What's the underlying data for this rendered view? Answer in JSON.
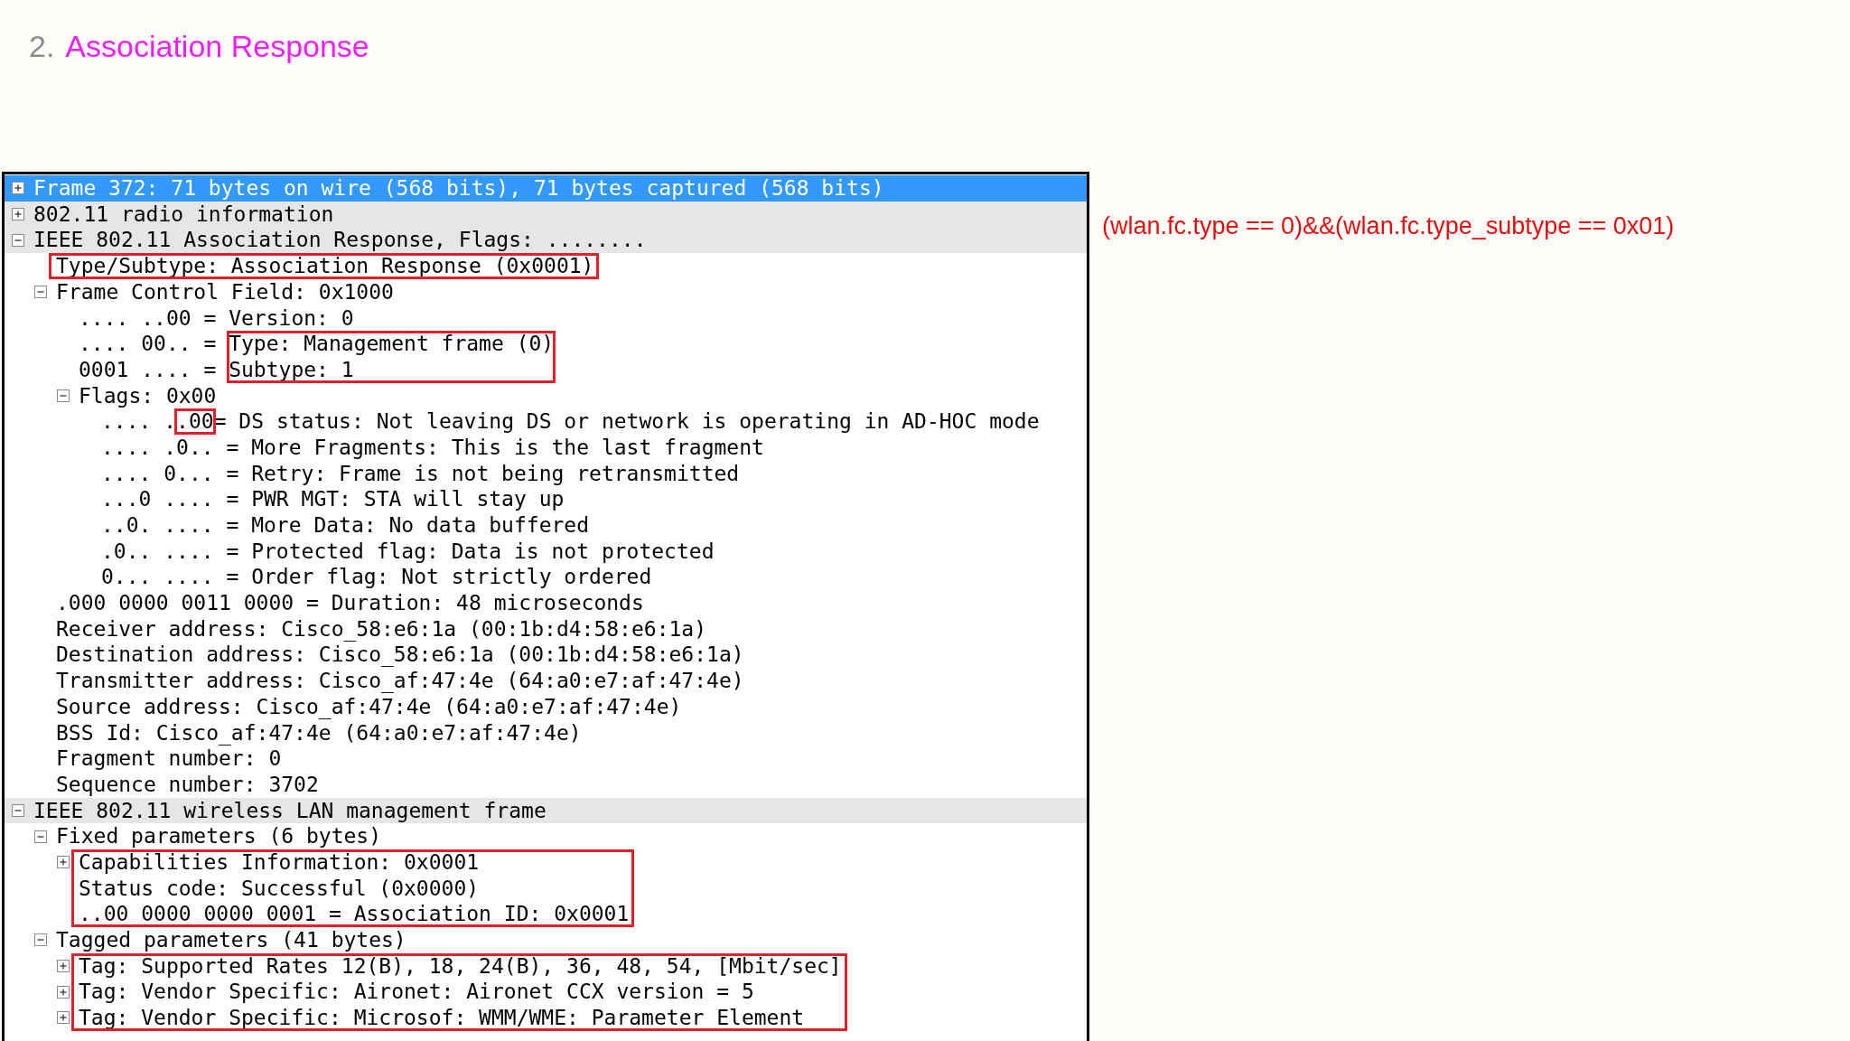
{
  "slide_title": {
    "number": "2.",
    "text": "Association Response"
  },
  "filter_note": "(wlan.fc.type == 0)&&(wlan.fc.type_subtype == 0x01)",
  "packet_details": [
    {
      "text": "Frame 372: 71 bytes on wire (568 bits), 71 bytes captured (568 bits)",
      "expanded": false,
      "selected": true
    },
    {
      "text": "802.11 radio information",
      "expanded": false,
      "selected": false
    },
    {
      "text": "IEEE 802.11 Association Response, Flags: ........",
      "expanded": true,
      "selected": false,
      "children": [
        {
          "text": "Type/Subtype: Association Response (0x0001)",
          "boxed": true
        },
        {
          "text": "Frame Control Field: 0x1000",
          "expanded": true,
          "children": [
            {
              "text": ".... ..00 = Version: 0"
            },
            {
              "parts": [
                {
                  "text": ".... 00.. = ",
                  "boxed": false
                },
                {
                  "text": "Type: Management frame (0)",
                  "boxed": true
                }
              ]
            },
            {
              "parts": [
                {
                  "text": "0001 .... = ",
                  "boxed": false
                },
                {
                  "text": "Subtype: 1",
                  "boxed": true
                }
              ]
            },
            {
              "text": "Flags: 0x00",
              "expanded": true,
              "children": [
                {
                  "parts": [
                    {
                      "text": ".... .",
                      "boxed": false
                    },
                    {
                      "text": ".00",
                      "boxed": true
                    },
                    {
                      "text": "= DS status: Not leaving DS or network is operating in AD-HOC mode",
                      "boxed": false
                    }
                  ]
                },
                {
                  "text": ".... .0.. = More Fragments: This is the last fragment"
                },
                {
                  "text": ".... 0... = Retry: Frame is not being retransmitted"
                },
                {
                  "text": "...0 .... = PWR MGT: STA will stay up"
                },
                {
                  "text": "..0. .... = More Data: No data buffered"
                },
                {
                  "text": ".0.. .... = Protected flag: Data is not protected"
                },
                {
                  "text": "0... .... = Order flag: Not strictly ordered"
                }
              ]
            }
          ]
        },
        {
          "text": ".000 0000 0011 0000 = Duration: 48 microseconds"
        },
        {
          "text": "Receiver address: Cisco_58:e6:1a (00:1b:d4:58:e6:1a)"
        },
        {
          "text": "Destination address: Cisco_58:e6:1a (00:1b:d4:58:e6:1a)"
        },
        {
          "text": "Transmitter address: Cisco_af:47:4e (64:a0:e7:af:47:4e)"
        },
        {
          "text": "Source address: Cisco_af:47:4e (64:a0:e7:af:47:4e)"
        },
        {
          "text": "BSS Id: Cisco_af:47:4e (64:a0:e7:af:47:4e)"
        },
        {
          "text": "Fragment number: 0"
        },
        {
          "text": "Sequence number: 3702"
        }
      ]
    },
    {
      "text": "IEEE 802.11 wireless LAN management frame",
      "expanded": true,
      "selected": false,
      "children": [
        {
          "text": "Fixed parameters (6 bytes)",
          "expanded": true,
          "children": [
            {
              "text": "Capabilities Information: 0x0001",
              "expanded": false,
              "boxed": true
            },
            {
              "text": "Status code: Successful (0x0000)",
              "boxed": true
            },
            {
              "text": "..00 0000 0000 0001 = Association ID: 0x0001",
              "boxed": true
            }
          ]
        },
        {
          "text": "Tagged parameters (41 bytes)",
          "expanded": true,
          "children": [
            {
              "text": "Tag: Supported Rates 12(B), 18, 24(B), 36, 48, 54, [Mbit/sec]",
              "expanded": false,
              "boxed": true
            },
            {
              "text": "Tag: Vendor Specific: Aironet: Aironet CCX version = 5",
              "expanded": false,
              "boxed": true
            },
            {
              "text": "Tag: Vendor Specific: Microsof: WMM/WME: Parameter Element",
              "expanded": false,
              "boxed": true
            }
          ]
        }
      ]
    }
  ]
}
